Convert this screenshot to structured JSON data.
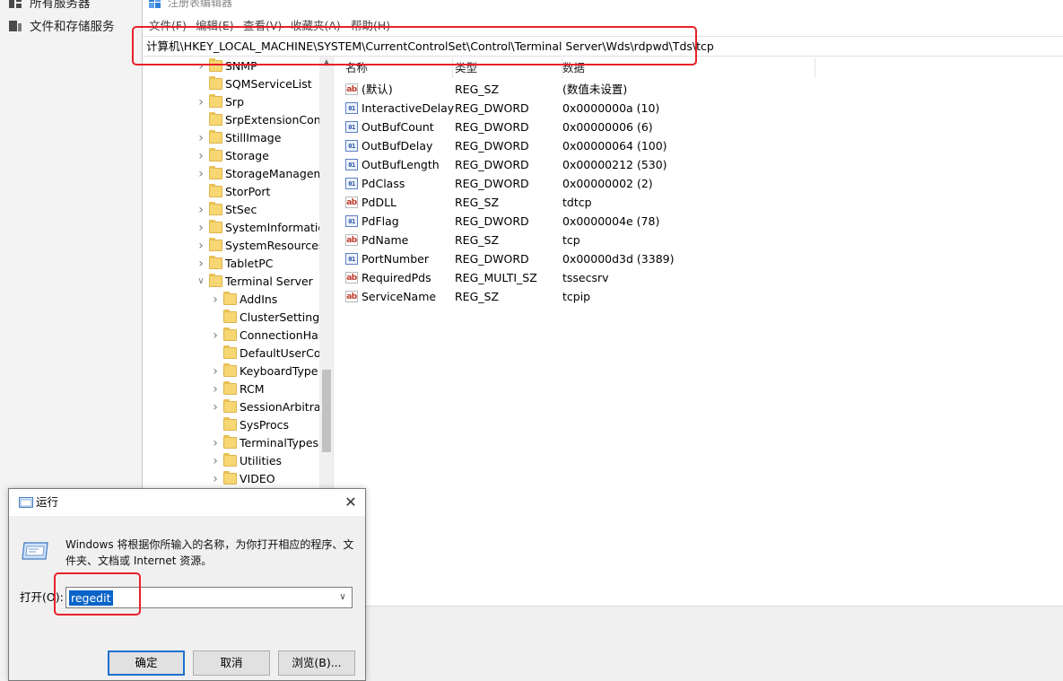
{
  "sidebar": {
    "items": [
      {
        "label": "所有服务器",
        "icon": "servers-icon"
      },
      {
        "label": "文件和存储服务",
        "icon": "storage-icon"
      }
    ]
  },
  "regedit": {
    "title": "注册表编辑器",
    "menu": [
      "文件(F)",
      "编辑(E)",
      "查看(V)",
      "收藏夹(A)",
      "帮助(H)"
    ],
    "address": "计算机\\HKEY_LOCAL_MACHINE\\SYSTEM\\CurrentControlSet\\Control\\Terminal Server\\Wds\\rdpwd\\Tds\\tcp",
    "tree": [
      {
        "label": "SNMP",
        "level": 1,
        "expander": "collapsed"
      },
      {
        "label": "SQMServiceList",
        "level": 1,
        "expander": "none"
      },
      {
        "label": "Srp",
        "level": 1,
        "expander": "collapsed"
      },
      {
        "label": "SrpExtensionConf",
        "level": 1,
        "expander": "none"
      },
      {
        "label": "StillImage",
        "level": 1,
        "expander": "collapsed"
      },
      {
        "label": "Storage",
        "level": 1,
        "expander": "collapsed"
      },
      {
        "label": "StorageManagem",
        "level": 1,
        "expander": "collapsed"
      },
      {
        "label": "StorPort",
        "level": 1,
        "expander": "none"
      },
      {
        "label": "StSec",
        "level": 1,
        "expander": "collapsed"
      },
      {
        "label": "SystemInformatio",
        "level": 1,
        "expander": "collapsed"
      },
      {
        "label": "SystemResources",
        "level": 1,
        "expander": "collapsed"
      },
      {
        "label": "TabletPC",
        "level": 1,
        "expander": "collapsed"
      },
      {
        "label": "Terminal Server",
        "level": 1,
        "expander": "expanded"
      },
      {
        "label": "AddIns",
        "level": 2,
        "expander": "collapsed"
      },
      {
        "label": "ClusterSettings",
        "level": 2,
        "expander": "none"
      },
      {
        "label": "ConnectionHan",
        "level": 2,
        "expander": "collapsed"
      },
      {
        "label": "DefaultUserCor",
        "level": 2,
        "expander": "none"
      },
      {
        "label": "KeyboardType",
        "level": 2,
        "expander": "collapsed"
      },
      {
        "label": "RCM",
        "level": 2,
        "expander": "collapsed"
      },
      {
        "label": "SessionArbitrat",
        "level": 2,
        "expander": "collapsed"
      },
      {
        "label": "SysProcs",
        "level": 2,
        "expander": "none"
      },
      {
        "label": "TerminalTypes",
        "level": 2,
        "expander": "collapsed"
      },
      {
        "label": "Utilities",
        "level": 2,
        "expander": "collapsed"
      },
      {
        "label": "VIDEO",
        "level": 2,
        "expander": "collapsed"
      }
    ],
    "columns": {
      "name": "名称",
      "type": "类型",
      "data": "数据"
    },
    "values": [
      {
        "icon": "string",
        "name": "(默认)",
        "type": "REG_SZ",
        "data": "(数值未设置)"
      },
      {
        "icon": "binary",
        "name": "InteractiveDelay",
        "type": "REG_DWORD",
        "data": "0x0000000a (10)"
      },
      {
        "icon": "binary",
        "name": "OutBufCount",
        "type": "REG_DWORD",
        "data": "0x00000006 (6)"
      },
      {
        "icon": "binary",
        "name": "OutBufDelay",
        "type": "REG_DWORD",
        "data": "0x00000064 (100)"
      },
      {
        "icon": "binary",
        "name": "OutBufLength",
        "type": "REG_DWORD",
        "data": "0x00000212 (530)"
      },
      {
        "icon": "binary",
        "name": "PdClass",
        "type": "REG_DWORD",
        "data": "0x00000002 (2)"
      },
      {
        "icon": "string",
        "name": "PdDLL",
        "type": "REG_SZ",
        "data": "tdtcp"
      },
      {
        "icon": "binary",
        "name": "PdFlag",
        "type": "REG_DWORD",
        "data": "0x0000004e (78)"
      },
      {
        "icon": "string",
        "name": "PdName",
        "type": "REG_SZ",
        "data": "tcp"
      },
      {
        "icon": "binary",
        "name": "PortNumber",
        "type": "REG_DWORD",
        "data": "0x00000d3d (3389)"
      },
      {
        "icon": "string",
        "name": "RequiredPds",
        "type": "REG_MULTI_SZ",
        "data": "tssecsrv"
      },
      {
        "icon": "string",
        "name": "ServiceName",
        "type": "REG_SZ",
        "data": "tcpip"
      }
    ]
  },
  "run_dialog": {
    "title": "运行",
    "description": "Windows 将根据你所输入的名称，为你打开相应的程序、文件夹、文档或 Internet 资源。",
    "open_label": "打开(O):",
    "input_value": "regedit",
    "buttons": {
      "ok": "确定",
      "cancel": "取消",
      "browse": "浏览(B)..."
    }
  },
  "colors": {
    "highlight": "#e8212a",
    "selection": "#0a64c8",
    "folder": "#f7d774"
  }
}
